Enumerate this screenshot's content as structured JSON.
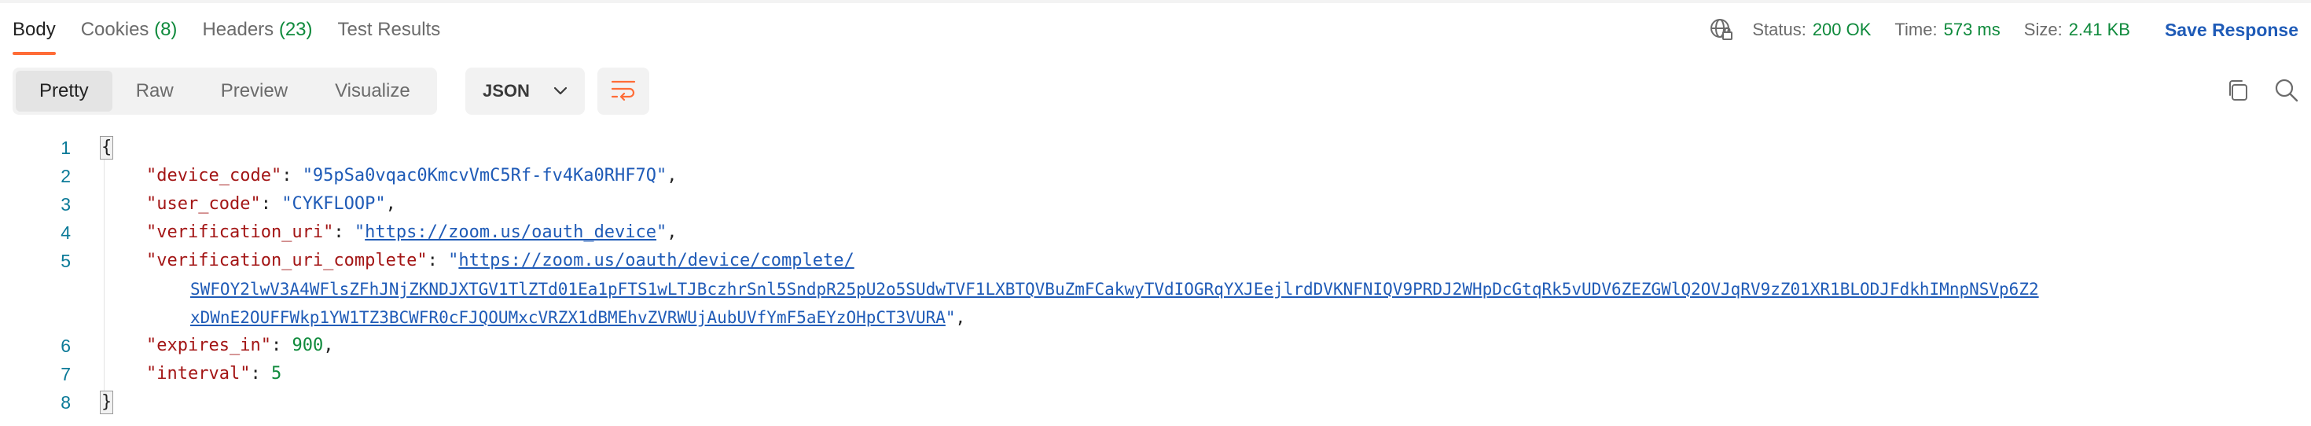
{
  "tabs": [
    {
      "label": "Body",
      "count": ""
    },
    {
      "label": "Cookies",
      "count": "(8)"
    },
    {
      "label": "Headers",
      "count": "(23)"
    },
    {
      "label": "Test Results",
      "count": ""
    }
  ],
  "status": {
    "status_label": "Status:",
    "status_value": "200 OK",
    "time_label": "Time:",
    "time_value": "573 ms",
    "size_label": "Size:",
    "size_value": "2.41 KB",
    "save_label": "Save Response"
  },
  "view_modes": [
    "Pretty",
    "Raw",
    "Preview",
    "Visualize"
  ],
  "format": "JSON",
  "icons": {
    "globe": "globe-icon",
    "chevron": "chevron-down-icon",
    "wrap": "wrap-lines-icon",
    "copy": "copy-icon",
    "search": "search-icon"
  },
  "colors": {
    "accent": "#ff6c37",
    "success": "#0f8a3c",
    "link": "#1f5bb7",
    "key": "#a31515"
  },
  "code": {
    "line_numbers": [
      "1",
      "2",
      "3",
      "4",
      "5",
      "6",
      "7",
      "8"
    ],
    "open_brace": "{",
    "close_brace": "}",
    "device_code_key": "\"device_code\"",
    "device_code_value": "\"95pSa0vqac0KmcvVmC5Rf-fv4Ka0RHF7Q\"",
    "user_code_key": "\"user_code\"",
    "user_code_value": "\"CYKFLOOP\"",
    "verification_uri_key": "\"verification_uri\"",
    "verification_uri_value": "https://zoom.us/oauth_device",
    "verification_uri_complete_key": "\"verification_uri_complete\"",
    "verification_uri_complete_value": [
      "https://zoom.us/oauth/device/complete/",
      "SWFOY2lwV3A4WFlsZFhJNjZKNDJXTGV1TlZTd01Ea1pFTS1wLTJBczhrSnl5SndpR25pU2o5SUdwTVF1LXBTQVBuZmFCakwyTVdIOGRqYXJEejlrdDVKNFNIQV9PRDJ2WHpDcGtqRk5vUDV6ZEZGWlQ2OVJqRV9zZ01XR1BLODJFdkhIMnpNSVp6Z2",
      "xDWnE2OUFFWkp1YW1TZ3BCWFR0cFJQOUMxcVRZX1dBMEhvZVRWUjAubUVfYmF5aEYzOHpCT3VURA"
    ],
    "expires_in_key": "\"expires_in\"",
    "expires_in_value": "900",
    "interval_key": "\"interval\"",
    "interval_value": "5"
  }
}
